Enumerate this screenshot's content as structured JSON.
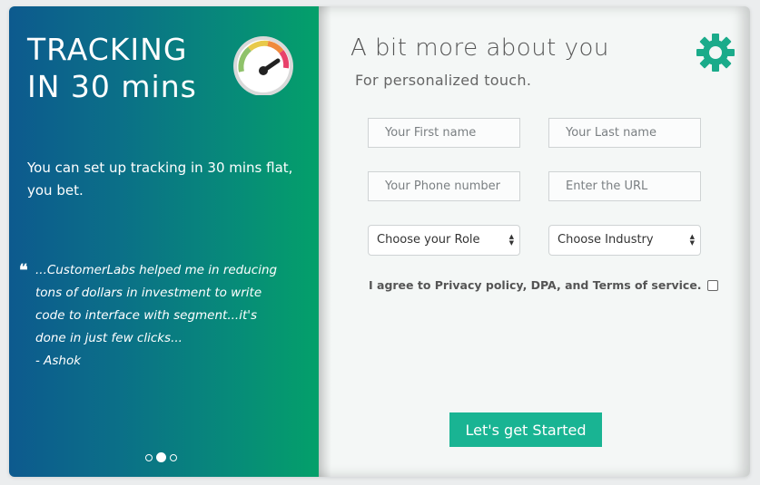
{
  "promo": {
    "headline": "TRACKING IN 30 mins",
    "subtext": "You can set up tracking in 30 mins flat, you bet.",
    "quote": "...CustomerLabs helped me in reducing tons of dollars in investment to write code to interface with segment...it's done in just few clicks...\n- Ashok",
    "quote_mark": "❝",
    "carousel": {
      "total": 3,
      "active": 2
    }
  },
  "form": {
    "title": "A bit more about you",
    "subtitle": "For personalized touch.",
    "first_name_placeholder": "Your First name",
    "last_name_placeholder": "Your Last name",
    "phone_placeholder": "Your Phone number",
    "url_placeholder": "Enter the URL",
    "role_selected": "Choose your Role",
    "industry_selected": "Choose Industry",
    "agree_text": "I agree to Privacy policy, DPA, and Terms of service.",
    "submit_label": "Let's get Started"
  },
  "colors": {
    "accent": "#19b493",
    "gear": "#1aab8a",
    "gradient_start": "#0d5a8e",
    "gradient_end": "#04a06a"
  },
  "icons": {
    "gauge": "speedometer-icon",
    "settings": "gear-icon",
    "select_arrows": "updown-arrows-icon"
  }
}
